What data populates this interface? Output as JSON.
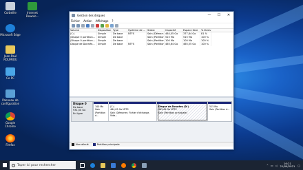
{
  "desktop": {
    "icons": [
      {
        "label": "Corbeille",
        "icon": "recycle-bin-icon"
      },
      {
        "label": "Internet Downlo...",
        "icon": "internet-download-manager-icon"
      },
      {
        "label": "Microsoft Edge",
        "icon": "edge-icon"
      },
      {
        "label": "Jean-Paul ROUMIOU",
        "icon": "user-folder-icon"
      },
      {
        "label": "Ce PC",
        "icon": "this-pc-icon"
      },
      {
        "label": "Panneau de configuration",
        "icon": "control-panel-icon"
      },
      {
        "label": "Google Chrome",
        "icon": "chrome-icon"
      },
      {
        "label": "Firefox",
        "icon": "firefox-icon"
      }
    ]
  },
  "window": {
    "title": "Gestion des disques",
    "menu": [
      "Fichier",
      "Action",
      "Affichage",
      "?"
    ],
    "columns": [
      "Volume",
      "Disposition",
      "Type",
      "Système de ...",
      "Statut",
      "Capacité",
      "Espace libre",
      "% libres"
    ],
    "rows": [
      [
        "(C:)",
        "Simple",
        "De base",
        "NTFS",
        "Sain (Démarr...",
        "464,05 Go",
        "377,84 Go",
        "81 %"
      ],
      [
        "(Disque 0 partition...",
        "Simple",
        "De base",
        "",
        "Sain (Partition...",
        "515 Mo",
        "515 Mo",
        "100 %"
      ],
      [
        "(Disque 0 partition...",
        "Simple",
        "De base",
        "",
        "Sain (Partition...",
        "100 Mo",
        "100 Mo",
        "100 %"
      ],
      [
        "Disque de Donnée...",
        "Simple",
        "De base",
        "NTFS",
        "Sain (Partition...",
        "465,64 Go",
        "465,55 Go",
        "100 %"
      ]
    ],
    "disk": {
      "name": "Disque 0",
      "type": "De base",
      "size": "931,50 Go",
      "status": "En ligne",
      "partitions": [
        {
          "size": "100 Mo",
          "status": "Sain (Partition d..."
        },
        {
          "name": "(C:)",
          "size": "464,05 Go NTFS",
          "status": "Sain (Démarrer, Fichier d'échange, Vida..."
        },
        {
          "name": "Disque de Données (D:)",
          "size": "465,64 Go NTFS",
          "status": "Sain (Partition principale)"
        },
        {
          "size": "515 Mo",
          "status": "Sain (Partition d..."
        }
      ]
    },
    "legend": [
      {
        "label": "Non alloué",
        "color": "#1a1a1a"
      },
      {
        "label": "Partition principale",
        "color": "#1f2a7a"
      }
    ]
  },
  "taskbar": {
    "search_placeholder": "Taper ici pour rechercher",
    "time": "16:21",
    "date": "21/09/2021"
  }
}
